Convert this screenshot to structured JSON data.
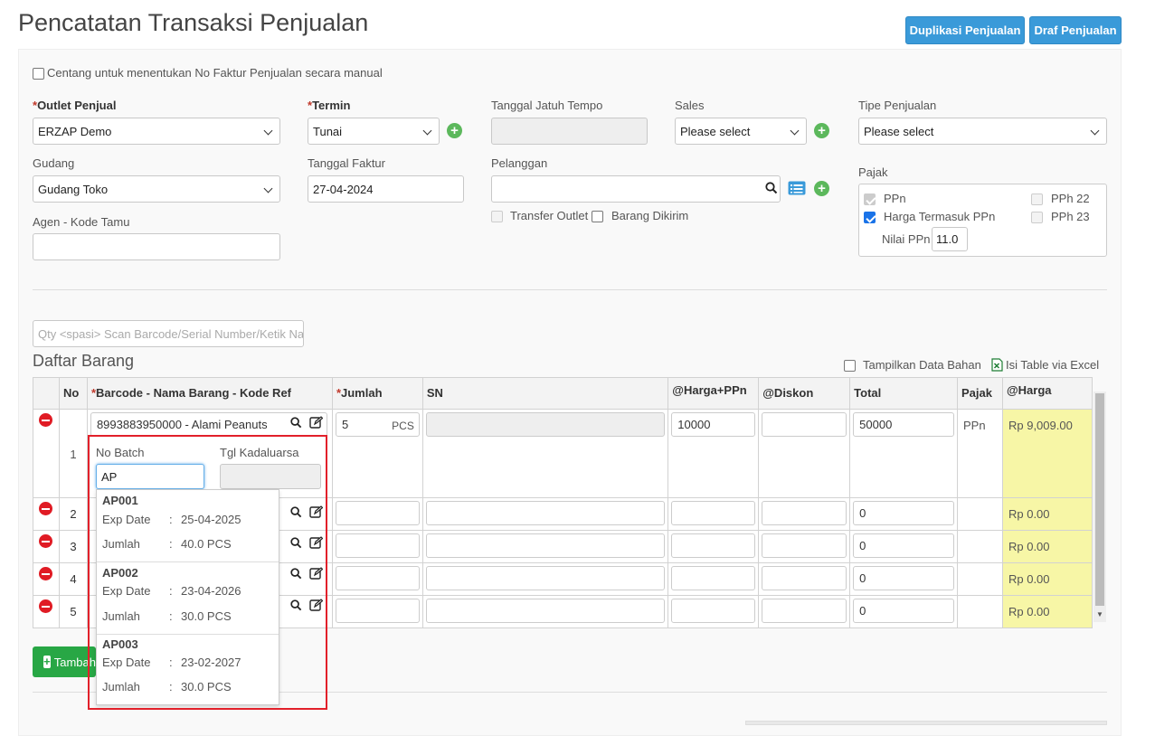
{
  "page_title": "Pencatatan Transaksi Penjualan",
  "header_buttons": {
    "duplicate": "Duplikasi Penjualan",
    "draft": "Draf Penjualan"
  },
  "manual_invoice_checkbox": "Centang untuk menentukan No Faktur Penjualan secara manual",
  "form": {
    "outlet": {
      "label": "Outlet Penjual",
      "value": "ERZAP Demo"
    },
    "termin": {
      "label": "Termin",
      "value": "Tunai"
    },
    "due_date": {
      "label": "Tanggal Jatuh Tempo"
    },
    "sales": {
      "label": "Sales",
      "value": "Please select"
    },
    "sale_type": {
      "label": "Tipe Penjualan",
      "value": "Please select"
    },
    "warehouse": {
      "label": "Gudang",
      "value": "Gudang Toko"
    },
    "invoice_date": {
      "label": "Tanggal Faktur",
      "value": "27-04-2024"
    },
    "customer": {
      "label": "Pelanggan",
      "value": ""
    },
    "transfer_outlet": "Transfer Outlet",
    "goods_sent": "Barang Dikirim",
    "agent": {
      "label": "Agen - Kode Tamu",
      "value": ""
    },
    "tax": {
      "label": "Pajak",
      "ppn": "PPn",
      "price_incl": "Harga Termasuk PPn",
      "pph22": "PPh 22",
      "pph23": "PPh 23",
      "ppn_value_label": "Nilai PPn",
      "ppn_value": "11.0"
    }
  },
  "scan": {
    "placeholder": "Qty <spasi> Scan Barcode/Serial Number/Ketik Nama"
  },
  "items_title": "Daftar Barang",
  "show_materials": "Tampilkan Data Bahan",
  "excel_link": "Isi Table via Excel",
  "table": {
    "headers": {
      "no": "No",
      "barcode": "Barcode - Nama Barang - Kode Ref",
      "qty": "Jumlah",
      "sn": "SN",
      "price_ppn": "@Harga+PPn",
      "discount": "@Diskon",
      "total": "Total",
      "tax": "Pajak",
      "price": "@Harga"
    },
    "rows": [
      {
        "no": "1",
        "item": "8993883950000 - Alami Peanuts",
        "qty": "5",
        "unit": "PCS",
        "price_ppn": "10000",
        "total": "50000",
        "tax": "PPn",
        "price": "Rp 9,009.00"
      },
      {
        "no": "2",
        "total": "0",
        "price": "Rp 0.00"
      },
      {
        "no": "3",
        "total": "0",
        "price": "Rp 0.00"
      },
      {
        "no": "4",
        "total": "0",
        "price": "Rp 0.00"
      },
      {
        "no": "5",
        "total": "0",
        "price": "Rp 0.00"
      }
    ]
  },
  "batch": {
    "label_batch": "No Batch",
    "label_exp": "Tgl Kadaluarsa",
    "input": "AP"
  },
  "batch_options": [
    {
      "code": "AP001",
      "exp_label": "Exp Date",
      "exp": "25-04-2025",
      "qty_label": "Jumlah",
      "qty": "40.0 PCS"
    },
    {
      "code": "AP002",
      "exp_label": "Exp Date",
      "exp": "23-04-2026",
      "qty_label": "Jumlah",
      "qty": "30.0 PCS"
    },
    {
      "code": "AP003",
      "exp_label": "Exp Date",
      "exp": "23-02-2027",
      "qty_label": "Jumlah",
      "qty": "30.0 PCS"
    }
  ],
  "add_button": "Tambah",
  "colors": {
    "primary": "#3a9ad9",
    "success": "#28a745",
    "danger": "#e01b24",
    "highlight": "#f7f6a6"
  }
}
